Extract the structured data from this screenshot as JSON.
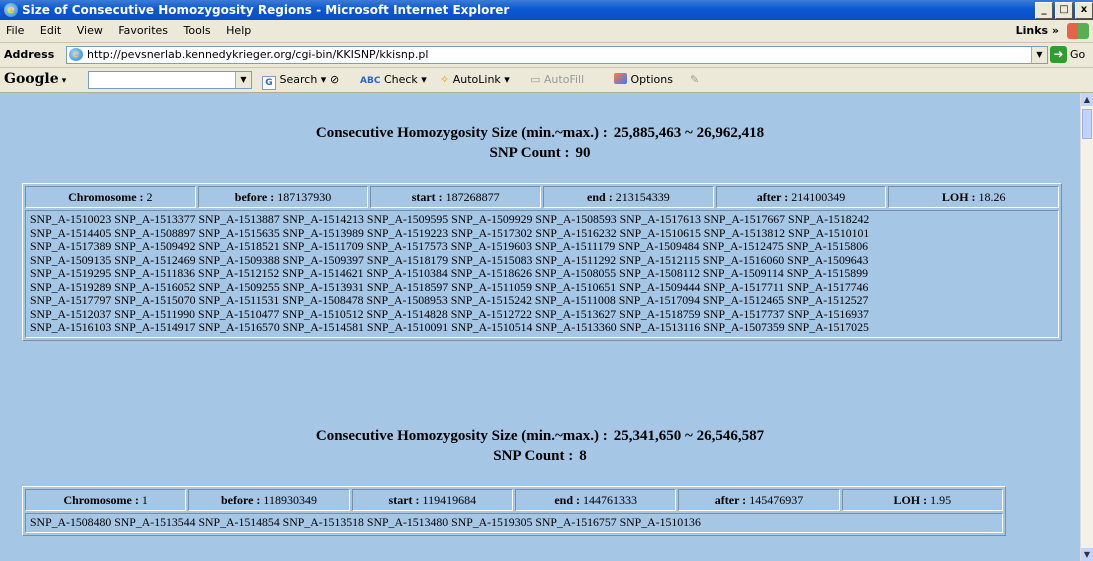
{
  "window": {
    "title": "Size of Consecutive Homozygosity Regions - Microsoft Internet Explorer"
  },
  "menu": {
    "items": [
      "File",
      "Edit",
      "View",
      "Favorites",
      "Tools",
      "Help"
    ],
    "links_label": "Links"
  },
  "address": {
    "label": "Address",
    "url": "http://pevsnerlab.kennedykrieger.org/cgi-bin/KKISNP/kkisnp.pl",
    "go_label": "Go"
  },
  "google_toolbar": {
    "logo": "Google",
    "search_label": "Search",
    "check_label": "Check",
    "autolink_label": "AutoLink",
    "autofill_label": "AutoFill",
    "options_label": "Options"
  },
  "sections": [
    {
      "size_label": "Consecutive Homozygosity Size (min.~max.) :",
      "size_value": "25,885,463 ~ 26,962,418",
      "count_label": "SNP Count :",
      "count_value": "90",
      "cells": [
        {
          "label": "Chromosome :",
          "value": "2"
        },
        {
          "label": "before :",
          "value": "187137930"
        },
        {
          "label": "start :",
          "value": "187268877"
        },
        {
          "label": "end :",
          "value": "213154339"
        },
        {
          "label": "after :",
          "value": "214100349"
        },
        {
          "label": "LOH :",
          "value": "18.26"
        }
      ],
      "snp_lines": [
        "SNP_A-1510023 SNP_A-1513377 SNP_A-1513887 SNP_A-1514213 SNP_A-1509595 SNP_A-1509929 SNP_A-1508593 SNP_A-1517613 SNP_A-1517667 SNP_A-1518242",
        "SNP_A-1514405 SNP_A-1508897 SNP_A-1515635 SNP_A-1513989 SNP_A-1519223 SNP_A-1517302 SNP_A-1516232 SNP_A-1510615 SNP_A-1513812 SNP_A-1510101",
        "SNP_A-1517389 SNP_A-1509492 SNP_A-1518521 SNP_A-1511709 SNP_A-1517573 SNP_A-1519603 SNP_A-1511179 SNP_A-1509484 SNP_A-1512475 SNP_A-1515806",
        "SNP_A-1509135 SNP_A-1512469 SNP_A-1509388 SNP_A-1509397 SNP_A-1518179 SNP_A-1515083 SNP_A-1511292 SNP_A-1512115 SNP_A-1516060 SNP_A-1509643",
        "SNP_A-1519295 SNP_A-1511836 SNP_A-1512152 SNP_A-1514621 SNP_A-1510384 SNP_A-1518626 SNP_A-1508055 SNP_A-1508112 SNP_A-1509114 SNP_A-1515899",
        "SNP_A-1519289 SNP_A-1516052 SNP_A-1509255 SNP_A-1513931 SNP_A-1518597 SNP_A-1511059 SNP_A-1510651 SNP_A-1509444 SNP_A-1517711 SNP_A-1517746",
        "SNP_A-1517797 SNP_A-1515070 SNP_A-1511531 SNP_A-1508478 SNP_A-1508953 SNP_A-1515242 SNP_A-1511008 SNP_A-1517094 SNP_A-1512465 SNP_A-1512527",
        "SNP_A-1512037 SNP_A-1511990 SNP_A-1510477 SNP_A-1510512 SNP_A-1514828 SNP_A-1512722 SNP_A-1513627 SNP_A-1518759 SNP_A-1517737 SNP_A-1516937",
        "SNP_A-1516103 SNP_A-1514917 SNP_A-1516570 SNP_A-1514581 SNP_A-1510091 SNP_A-1510514 SNP_A-1513360 SNP_A-1513116 SNP_A-1507359 SNP_A-1517025"
      ]
    },
    {
      "size_label": "Consecutive Homozygosity Size (min.~max.) :",
      "size_value": "25,341,650 ~ 26,546,587",
      "count_label": "SNP Count :",
      "count_value": "8",
      "cells": [
        {
          "label": "Chromosome :",
          "value": "1"
        },
        {
          "label": "before :",
          "value": "118930349"
        },
        {
          "label": "start :",
          "value": "119419684"
        },
        {
          "label": "end :",
          "value": "144761333"
        },
        {
          "label": "after :",
          "value": "145476937"
        },
        {
          "label": "LOH :",
          "value": "1.95"
        }
      ],
      "snp_lines": [
        "SNP_A-1508480 SNP_A-1513544 SNP_A-1514854 SNP_A-1513518 SNP_A-1513480 SNP_A-1519305 SNP_A-1516757 SNP_A-1510136"
      ]
    }
  ]
}
